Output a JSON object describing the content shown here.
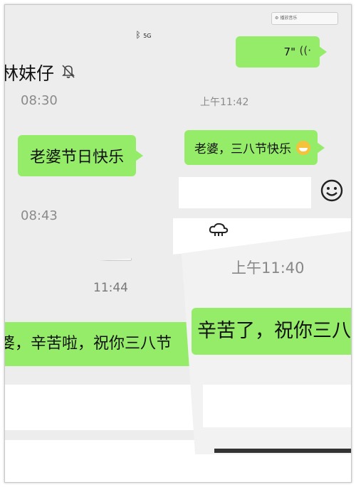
{
  "panel1": {
    "contact_name": "林妹仔",
    "signal_label": "5G",
    "times": [
      "08:30",
      "08:43"
    ],
    "message": "老婆节日快乐"
  },
  "panel2": {
    "mini_toolbar_label": "播放音乐",
    "voice_duration": "7\"",
    "time": "上午11:42",
    "message": "老婆，三八节快乐"
  },
  "panel3": {
    "time": "11:44",
    "message": "婆，辛苦啦，祝你三八节"
  },
  "panel4": {
    "time": "上午11:40",
    "message": "辛苦了，祝你三八"
  },
  "colors": {
    "bubble": "#95ec69",
    "chat_bg": "#ededed"
  }
}
